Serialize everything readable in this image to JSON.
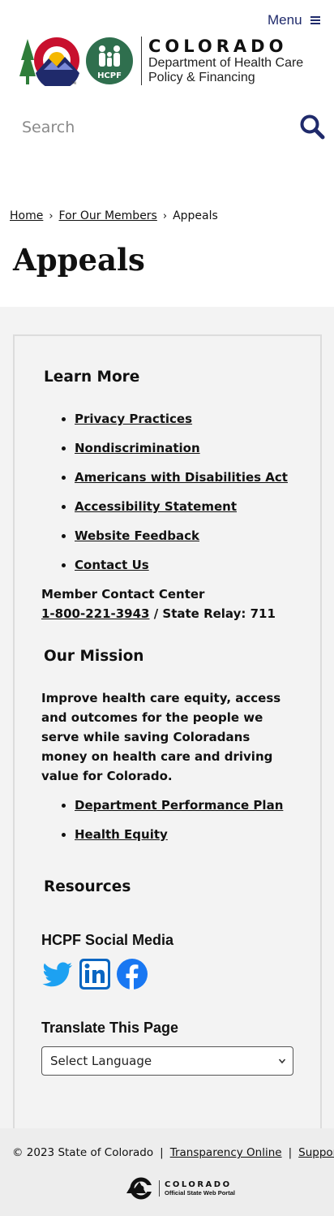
{
  "header": {
    "menu_label": "Menu",
    "logo_title": "COLORADO",
    "logo_sub_line1": "Department of Health Care",
    "logo_sub_line2": "Policy & Financing",
    "hcpf_badge": "HCPF"
  },
  "search": {
    "placeholder": "Search"
  },
  "breadcrumb": {
    "home": "Home",
    "members": "For Our Members",
    "current": "Appeals",
    "separator": "›"
  },
  "page_title": "Appeals",
  "learn_more": {
    "heading": "Learn More",
    "links": [
      "Privacy Practices",
      "Nondiscrimination",
      "Americans with Disabilities Act",
      "Accessibility Statement",
      "Website Feedback",
      "Contact Us"
    ],
    "contact_label": "Member Contact Center",
    "phone": "1-800-221-3943",
    "relay": " / State Relay: 711"
  },
  "mission": {
    "heading": "Our Mission",
    "text": "Improve health care equity, access and outcomes for the people we serve while saving Coloradans money on health care and driving value for Colorado.",
    "links": [
      "Department Performance Plan",
      "Health Equity"
    ]
  },
  "resources": {
    "heading": "Resources"
  },
  "social": {
    "heading": "HCPF Social Media",
    "icons": [
      "twitter-icon",
      "linkedin-icon",
      "facebook-icon"
    ]
  },
  "translate": {
    "heading": "Translate This Page",
    "selected": "Select Language"
  },
  "footer": {
    "copyright": "© 2023 State of Colorado",
    "sep": "|",
    "transparency": "Transparency Online",
    "support": "Support",
    "portal_title": "COLORADO",
    "portal_sub": "Official State Web Portal"
  },
  "colors": {
    "brand_navy": "#1f2a6b",
    "hcpf_green": "#2f6f4e",
    "twitter": "#1da1f2",
    "linkedin": "#0a66c2",
    "facebook": "#1877f2"
  }
}
